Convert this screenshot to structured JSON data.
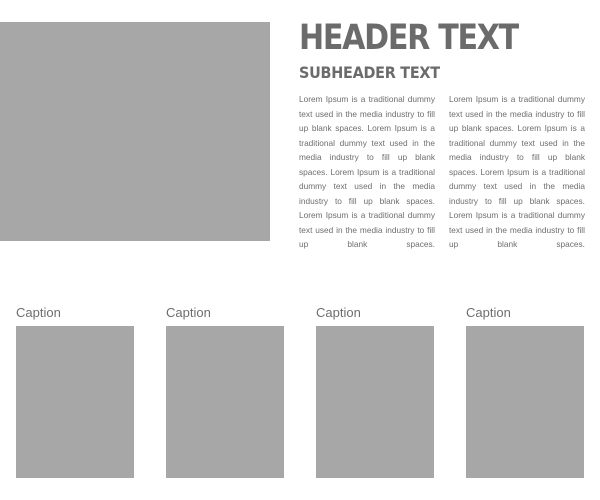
{
  "hero": {
    "image_color": "#a7a7a7"
  },
  "header": {
    "title": "HEADER TEXT",
    "subtitle": "SUBHEADER TEXT"
  },
  "body": {
    "column_1": "Lorem Ipsum is a traditional dummy text used in the media industry to fill up blank spaces. Lorem Ipsum is a traditional dummy text used in the media industry to fill up blank spaces. Lorem Ipsum is a traditional dummy text used in the media industry to fill up blank spaces. Lorem Ipsum is a traditional dummy text used in the media industry to fill up blank spaces.",
    "column_2": "Lorem Ipsum is a traditional dummy text used in the media industry to fill up blank spaces. Lorem Ipsum is a traditional dummy text used in the media industry to fill up blank spaces. Lorem Ipsum is a traditional dummy text used in the media industry to fill up blank spaces. Lorem Ipsum is a traditional dummy text used in the media industry to fill up blank spaces."
  },
  "gallery": {
    "items": [
      {
        "caption": "Caption"
      },
      {
        "caption": "Caption"
      },
      {
        "caption": "Caption"
      },
      {
        "caption": "Caption"
      }
    ]
  },
  "colors": {
    "placeholder_gray": "#a7a7a7",
    "text_gray": "#6e6e6e"
  }
}
